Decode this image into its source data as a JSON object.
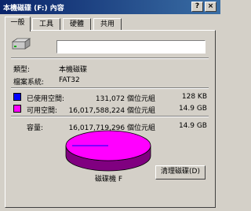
{
  "window": {
    "title": "本機磁碟 (F:) 內容",
    "help_label": "?",
    "close_label": "×"
  },
  "tabs": [
    {
      "label": "一般",
      "active": true
    },
    {
      "label": "工具",
      "active": false
    },
    {
      "label": "硬體",
      "active": false
    },
    {
      "label": "共用",
      "active": false
    }
  ],
  "general": {
    "drive_label_value": "",
    "type_label": "類型:",
    "type_value": "本機磁碟",
    "fs_label": "檔案系統:",
    "fs_value": "FAT32",
    "used_label": "已使用空間:",
    "used_bytes": "131,072 個位元組",
    "used_size": "128 KB",
    "free_label": "可用空間:",
    "free_bytes": "16,017,588,224 個位元組",
    "free_size": "14.9 GB",
    "capacity_label": "容量:",
    "capacity_bytes": "16,017,719,296 個位元組",
    "capacity_size": "14.9 GB",
    "drive_name": "磁碟機 F",
    "cleanup_button": "清理磁碟(D)",
    "used_color": "#0000ff",
    "free_color": "#ff00ff",
    "used_fraction": 8.2e-06
  },
  "icons": {
    "drive": "hard-drive-icon"
  }
}
